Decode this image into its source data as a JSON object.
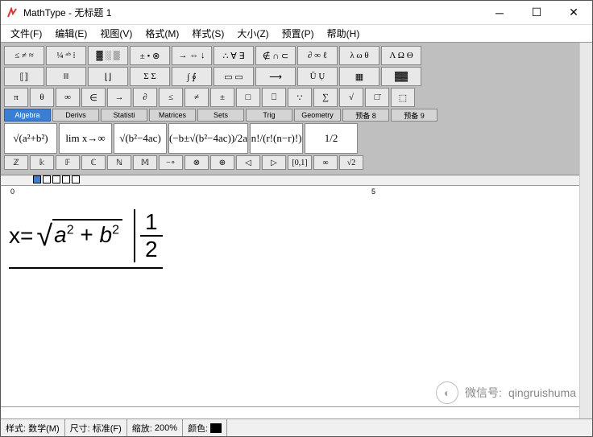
{
  "window": {
    "title": "MathType - 无标题 1"
  },
  "menu": {
    "file": "文件(F)",
    "edit": "编辑(E)",
    "view": "视图(V)",
    "format": "格式(M)",
    "style": "样式(S)",
    "size": "大小(Z)",
    "preset": "预置(P)",
    "help": "帮助(H)"
  },
  "toolbar": {
    "row1": [
      "≤ ≠ ≈",
      "¼ ᵃᵇ ⁞",
      "▓ ░ ▒",
      "± • ⊗",
      "→ ⇔ ↓",
      "∴ ∀ ∃",
      "∉ ∩ ⊂",
      "∂ ∞ ℓ",
      "λ ω θ",
      "Λ Ω Θ"
    ],
    "row2": [
      "⟦⟧",
      "‖‖",
      "⌊⌋",
      "Σ Σ",
      "∫ ∮",
      "▭ ▭",
      "⟶",
      "Ū Ụ",
      "▦",
      "▓▓"
    ],
    "row3": [
      "π",
      "θ",
      "∞",
      "∈",
      "→",
      "∂",
      "≤",
      "≠",
      "±",
      "□",
      "⎕",
      "∵",
      "∑",
      "√",
      "□̄",
      "⬚"
    ],
    "tabs": [
      "Algebra",
      "Derivs",
      "Statisti",
      "Matrices",
      "Sets",
      "Trig",
      "Geometry",
      "预备 8",
      "预备 9"
    ],
    "templates": [
      "√(a²+b²)",
      "lim x→∞",
      "√(b²−4ac)",
      "(−b±√(b²−4ac))/2a",
      "n!/(r!(n−r)!)",
      "1/2"
    ],
    "row5": [
      "ℤ",
      "𝕜",
      "𝔽",
      "ℂ",
      "ℕ",
      "𝕄",
      "−∘",
      "⊗",
      "⊕",
      "◁",
      "▷",
      "[0,1]",
      "∞",
      "√2"
    ]
  },
  "ruler": {
    "zero": "0",
    "five": "5"
  },
  "equation": {
    "lhs": "x=",
    "rad_a": "a",
    "rad_plus": " + ",
    "rad_b": "b",
    "num": "1",
    "den": "2"
  },
  "watermark": {
    "label": "微信号:",
    "value": "qingruishuma"
  },
  "status": {
    "style_lbl": "样式:",
    "style_val": "数学(M)",
    "size_lbl": "尺寸:",
    "size_val": "标准(F)",
    "zoom_lbl": "缩放:",
    "zoom_val": "200%",
    "color_lbl": "颜色:"
  }
}
